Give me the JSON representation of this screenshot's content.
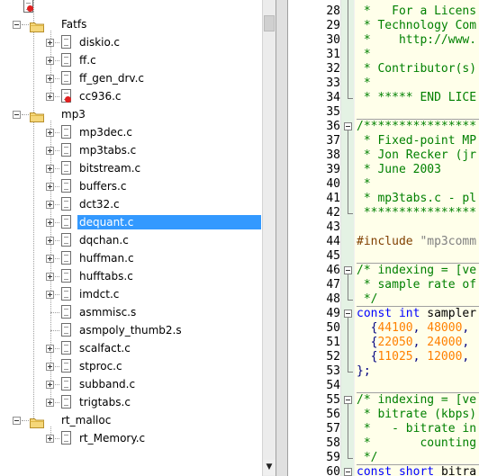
{
  "tree": {
    "items": [
      {
        "label": "",
        "level": 1,
        "kind": "root-partial"
      },
      {
        "label": "Fatfs",
        "level": 1,
        "kind": "folder"
      },
      {
        "label": "diskio.c",
        "level": 2,
        "kind": "file"
      },
      {
        "label": "ff.c",
        "level": 2,
        "kind": "file"
      },
      {
        "label": "ff_gen_drv.c",
        "level": 2,
        "kind": "file"
      },
      {
        "label": "cc936.c",
        "level": 2,
        "kind": "file-excluded"
      },
      {
        "label": "mp3",
        "level": 1,
        "kind": "folder"
      },
      {
        "label": "mp3dec.c",
        "level": 2,
        "kind": "file"
      },
      {
        "label": "mp3tabs.c",
        "level": 2,
        "kind": "file"
      },
      {
        "label": "bitstream.c",
        "level": 2,
        "kind": "file"
      },
      {
        "label": "buffers.c",
        "level": 2,
        "kind": "file"
      },
      {
        "label": "dct32.c",
        "level": 2,
        "kind": "file"
      },
      {
        "label": "dequant.c",
        "level": 2,
        "kind": "file",
        "selected": true
      },
      {
        "label": "dqchan.c",
        "level": 2,
        "kind": "file"
      },
      {
        "label": "huffman.c",
        "level": 2,
        "kind": "file"
      },
      {
        "label": "hufftabs.c",
        "level": 2,
        "kind": "file"
      },
      {
        "label": "imdct.c",
        "level": 2,
        "kind": "file"
      },
      {
        "label": "asmmisc.s",
        "level": 2,
        "kind": "asm"
      },
      {
        "label": "asmpoly_thumb2.s",
        "level": 2,
        "kind": "asm"
      },
      {
        "label": "scalfact.c",
        "level": 2,
        "kind": "file"
      },
      {
        "label": "stproc.c",
        "level": 2,
        "kind": "file"
      },
      {
        "label": "subband.c",
        "level": 2,
        "kind": "file"
      },
      {
        "label": "trigtabs.c",
        "level": 2,
        "kind": "file"
      },
      {
        "label": "rt_malloc",
        "level": 1,
        "kind": "folder"
      },
      {
        "label": "rt_Memory.c",
        "level": 2,
        "kind": "file"
      }
    ]
  },
  "editor": {
    "lines": [
      {
        "n": "28",
        "segs": [
          {
            "t": " *   For a Licens",
            "c": "com"
          }
        ]
      },
      {
        "n": "29",
        "segs": [
          {
            "t": " * Technology Com",
            "c": "com"
          }
        ]
      },
      {
        "n": "30",
        "segs": [
          {
            "t": " *    http://www.",
            "c": "com"
          }
        ]
      },
      {
        "n": "31",
        "segs": [
          {
            "t": " *",
            "c": "com"
          }
        ]
      },
      {
        "n": "32",
        "segs": [
          {
            "t": " * Contributor(s)",
            "c": "com"
          }
        ]
      },
      {
        "n": "33",
        "segs": [
          {
            "t": " *",
            "c": "com"
          }
        ]
      },
      {
        "n": "34",
        "segs": [
          {
            "t": " * ***** END LICE",
            "c": "com"
          }
        ]
      },
      {
        "n": "35",
        "segs": [
          {
            "t": "",
            "c": "txt"
          }
        ]
      },
      {
        "n": "36",
        "segs": [
          {
            "t": "/****************",
            "c": "com"
          }
        ]
      },
      {
        "n": "37",
        "segs": [
          {
            "t": " * Fixed-point MP",
            "c": "com"
          }
        ]
      },
      {
        "n": "38",
        "segs": [
          {
            "t": " * Jon Recker (jr",
            "c": "com"
          }
        ]
      },
      {
        "n": "39",
        "segs": [
          {
            "t": " * June 2003",
            "c": "com"
          }
        ]
      },
      {
        "n": "40",
        "segs": [
          {
            "t": " *",
            "c": "com"
          }
        ]
      },
      {
        "n": "41",
        "segs": [
          {
            "t": " * mp3tabs.c - pl",
            "c": "com"
          }
        ]
      },
      {
        "n": "42",
        "segs": [
          {
            "t": " ****************",
            "c": "com"
          }
        ]
      },
      {
        "n": "43",
        "segs": [
          {
            "t": "",
            "c": "txt"
          }
        ]
      },
      {
        "n": "44",
        "segs": [
          {
            "t": "#include ",
            "c": "pp"
          },
          {
            "t": "\"mp3comm",
            "c": "str"
          }
        ]
      },
      {
        "n": "45",
        "segs": [
          {
            "t": "",
            "c": "txt"
          }
        ]
      },
      {
        "n": "46",
        "segs": [
          {
            "t": "/* indexing = [ve",
            "c": "com"
          }
        ]
      },
      {
        "n": "47",
        "segs": [
          {
            "t": " * sample rate of",
            "c": "com"
          }
        ]
      },
      {
        "n": "48",
        "segs": [
          {
            "t": " */",
            "c": "com"
          }
        ]
      },
      {
        "n": "49",
        "segs": [
          {
            "t": "const ",
            "c": "kw"
          },
          {
            "t": "int ",
            "c": "kw"
          },
          {
            "t": "sampler",
            "c": "txt"
          }
        ]
      },
      {
        "n": "50",
        "segs": [
          {
            "t": "  {",
            "c": "op"
          },
          {
            "t": "44100",
            "c": "num"
          },
          {
            "t": ", ",
            "c": "op"
          },
          {
            "t": "48000",
            "c": "num"
          },
          {
            "t": ",",
            "c": "op"
          }
        ]
      },
      {
        "n": "51",
        "segs": [
          {
            "t": "  {",
            "c": "op"
          },
          {
            "t": "22050",
            "c": "num"
          },
          {
            "t": ", ",
            "c": "op"
          },
          {
            "t": "24000",
            "c": "num"
          },
          {
            "t": ",",
            "c": "op"
          }
        ]
      },
      {
        "n": "52",
        "segs": [
          {
            "t": "  {",
            "c": "op"
          },
          {
            "t": "11025",
            "c": "num"
          },
          {
            "t": ", ",
            "c": "op"
          },
          {
            "t": "12000",
            "c": "num"
          },
          {
            "t": ",",
            "c": "op"
          }
        ]
      },
      {
        "n": "53",
        "segs": [
          {
            "t": "};",
            "c": "op"
          }
        ]
      },
      {
        "n": "54",
        "segs": [
          {
            "t": "",
            "c": "txt"
          }
        ]
      },
      {
        "n": "55",
        "segs": [
          {
            "t": "/* indexing = [ve",
            "c": "com"
          }
        ]
      },
      {
        "n": "56",
        "segs": [
          {
            "t": " * bitrate (kbps)",
            "c": "com"
          }
        ]
      },
      {
        "n": "57",
        "segs": [
          {
            "t": " *   - bitrate in",
            "c": "com"
          }
        ]
      },
      {
        "n": "58",
        "segs": [
          {
            "t": " *       counting",
            "c": "com"
          }
        ]
      },
      {
        "n": "59",
        "segs": [
          {
            "t": " */",
            "c": "com"
          }
        ]
      },
      {
        "n": "60",
        "segs": [
          {
            "t": "const ",
            "c": "kw"
          },
          {
            "t": "short ",
            "c": "kw"
          },
          {
            "t": "bitra",
            "c": "txt"
          }
        ]
      }
    ]
  },
  "colors": {
    "selection": "#3399ff",
    "comment": "#008000",
    "keyword": "#0000ff",
    "number": "#ff8000",
    "string": "#808080",
    "preprocessor": "#804000",
    "code_background": "#ffffea"
  }
}
